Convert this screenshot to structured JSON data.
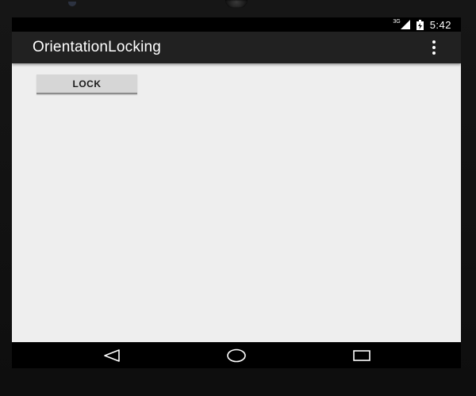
{
  "device": {
    "bezel_color": "#141414"
  },
  "status_bar": {
    "network_label": "3G",
    "time": "5:42",
    "signal_icon": "signal-icon",
    "battery_icon": "battery-charging-icon"
  },
  "app_bar": {
    "title": "OrientationLocking",
    "menu_icon": "overflow-menu-icon",
    "color": "#212121"
  },
  "content": {
    "lock_button_label": "LOCK",
    "background": "#eeeeee"
  },
  "nav_bar": {
    "back_icon": "back-icon",
    "home_icon": "home-icon",
    "recents_icon": "recents-icon"
  }
}
